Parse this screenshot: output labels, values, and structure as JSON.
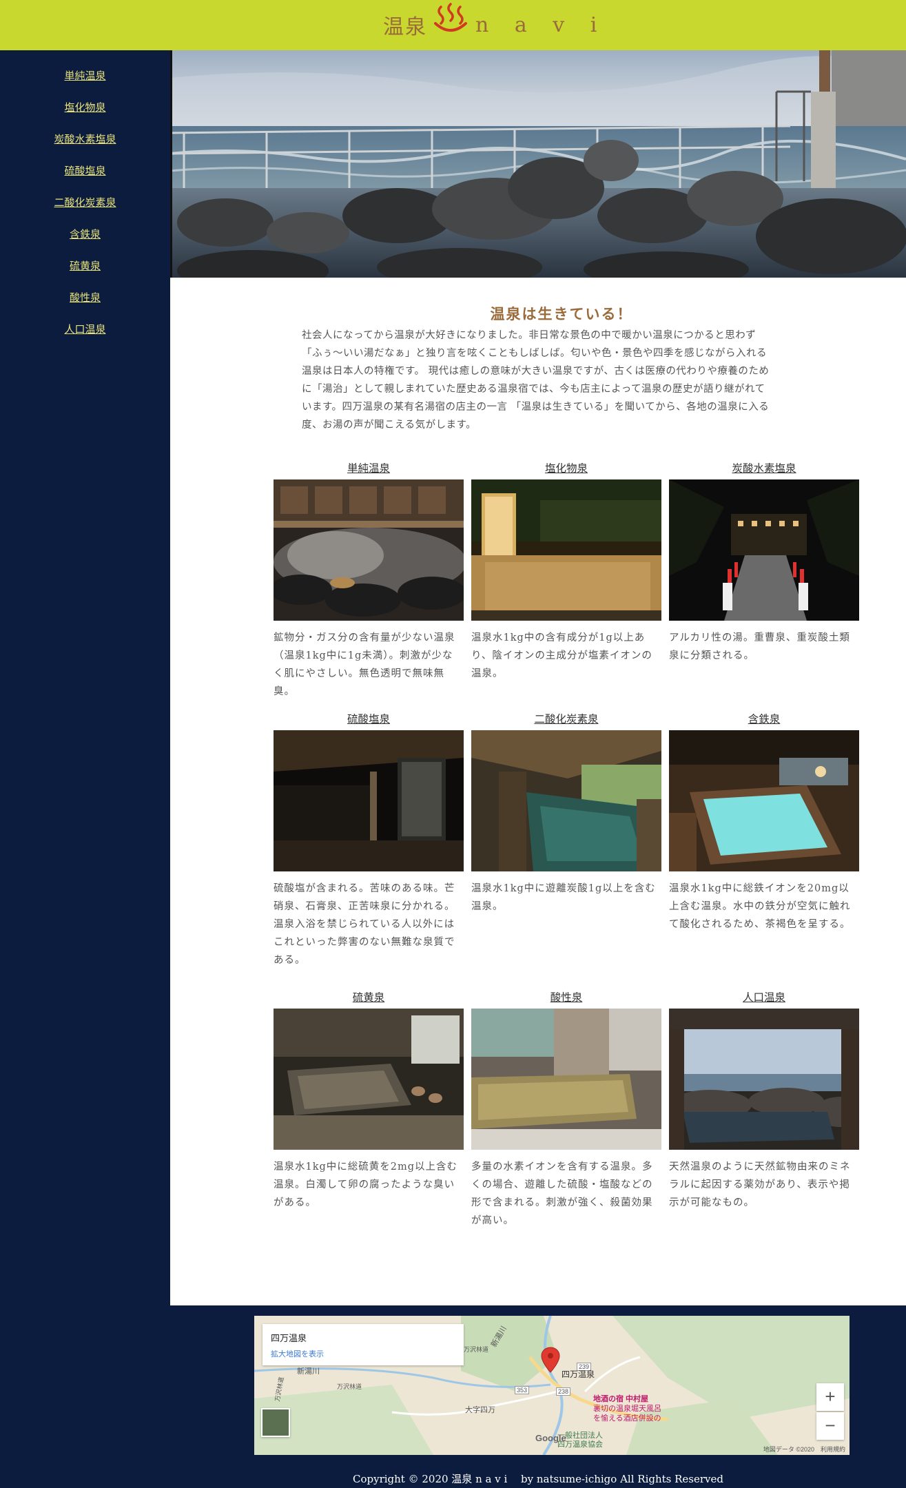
{
  "header": {
    "logo_text_a": "温泉",
    "logo_text_b": "n a v i",
    "background": "#c9d82e",
    "logo_color": "#9a6a3a",
    "logo_icon": "onsen-icon"
  },
  "sidebar": {
    "background": "#0b1c3f",
    "link_color": "#e8e27a",
    "items": [
      {
        "label": "単純温泉"
      },
      {
        "label": "塩化物泉"
      },
      {
        "label": "炭酸水素塩泉"
      },
      {
        "label": "硫酸塩泉"
      },
      {
        "label": "二酸化炭素泉"
      },
      {
        "label": "含鉄泉"
      },
      {
        "label": "硫黄泉"
      },
      {
        "label": "酸性泉"
      },
      {
        "label": "人口温泉"
      }
    ]
  },
  "hero": {
    "photo": "seaside-rock-bath-photo"
  },
  "intro": {
    "title": "温泉は生きている！",
    "text": "社会人になってから温泉が大好きになりました。非日常な景色の中で暖かい温泉につかると思わず「ふぅ〜いい湯だなぁ」と独り言を呟くこともしばしば。匂いや色・景色や四季を感じながら入れる温泉は日本人の特権です。 現代は癒しの意味が大きい温泉ですが、古くは医療の代わりや療養のために「湯治」として親しまれていた歴史ある温泉宿では、今も店主によって温泉の歴史が語り継がれています。四万温泉の某有名湯宿の店主の一言 「温泉は生きている」を聞いてから、各地の温泉に入る度、お湯の声が聞こえる気がします。"
  },
  "springs": [
    {
      "title": "単純温泉",
      "text": "鉱物分・ガス分の含有量が少ない温泉（温泉1kg中に1g未満）。刺激が少なく肌にやさしい。無色透明で無味無臭。",
      "photo": "misty-indoor-bath-photo"
    },
    {
      "title": "塩化物泉",
      "text": "温泉水1kg中の含有成分が1g以上あり、陰イオンの主成分が塩素イオンの温泉。",
      "photo": "night-lit-outdoor-bath-photo"
    },
    {
      "title": "炭酸水素塩泉",
      "text": "アルカリ性の湯。重曹泉、重炭酸土類泉に分類される。",
      "photo": "night-lantern-bridge-photo"
    },
    {
      "title": "硫酸塩泉",
      "text": "硫酸塩が含まれる。苦味のある味。芒硝泉、石膏泉、正苦味泉に分かれる。温泉入浴を禁じられている人以外にはこれといった弊害のない無難な泉質である。",
      "photo": "dark-wooden-bath-photo"
    },
    {
      "title": "二酸化炭素泉",
      "text": "温泉水1kg中に遊離炭酸1g以上を含む温泉。",
      "photo": "wooden-roof-outdoor-bath-photo"
    },
    {
      "title": "含鉄泉",
      "text": "温泉水1kg中に総鉄イオンを20mg以上含む温泉。水中の鉄分が空気に触れて酸化されるため、茶褐色を呈する。",
      "photo": "blue-lit-wooden-tub-photo"
    },
    {
      "title": "硫黄泉",
      "text": "温泉水1kg中に総硫黄を2mg以上含む温泉。白濁して卵の腐ったような臭いがある。",
      "photo": "stone-indoor-bath-photo"
    },
    {
      "title": "酸性泉",
      "text": "多量の水素イオンを含有する温泉。多くの場合、遊離した硫酸・塩酸などの形で含まれる。刺激が強く、殺菌効果が高い。",
      "photo": "tiled-indoor-bath-photo"
    },
    {
      "title": "人口温泉",
      "text": "天然温泉のように天然鉱物由来のミネラルに起因する薬効があり、表示や掲示が可能なもの。",
      "photo": "ocean-view-rock-bath-photo"
    }
  ],
  "map": {
    "place_name": "四万温泉",
    "enlarge_link": "拡大地図を表示",
    "pin_label": "四万温泉",
    "poi_lines": [
      "地酒の宿 中村屋",
      "裏切の温泉堀天風呂",
      "を愉える酒店併設の"
    ],
    "assoc_lines": [
      "一般社団法人",
      "四万温泉協会"
    ],
    "district_label": "大字四万",
    "river_label_a": "新湯川",
    "river_label_b": "新湯川",
    "road_label_a": "万沢林道",
    "road_label_b": "万沢林道",
    "road_label_c": "万沢林道",
    "route_a": "353",
    "route_b": "238",
    "route_c": "239",
    "zoom_in": "+",
    "zoom_out": "−",
    "google": "Google",
    "attribution": "地図データ ©2020　利用規約"
  },
  "footer": {
    "copyright": "Copyright © 2020 温泉 n a v i　 by natsume-ichigo All Rights Reserved"
  }
}
